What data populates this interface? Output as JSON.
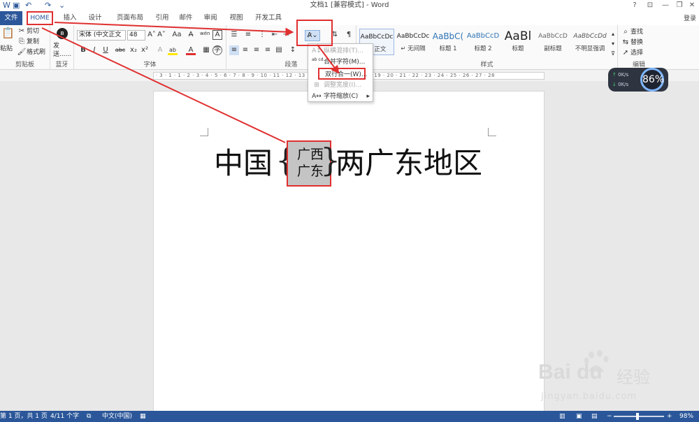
{
  "titlebar": {
    "title": "文档1 [兼容模式] - Word",
    "undo": "↶",
    "redo": "↷",
    "help": "?",
    "minimize": "—",
    "restore": "❐",
    "close": "✕"
  },
  "tabs": {
    "file": "文件",
    "home": "HOME",
    "items": [
      "插入",
      "设计",
      "页面布局",
      "引用",
      "邮件",
      "审阅",
      "视图",
      "开发工具"
    ],
    "login": "登录"
  },
  "clipboard": {
    "paste": "粘贴",
    "cut": "剪切",
    "copy": "复制",
    "format_painter": "格式刷",
    "group": "剪贴板",
    "send": "发送......",
    "bluetooth_group": "蓝牙"
  },
  "font": {
    "name": "宋体 (中文正文",
    "size": "48",
    "group": "字体",
    "grow": "A˄",
    "shrink": "A˅",
    "case": "Aa",
    "clear": "A̶",
    "phonetic": "wén",
    "border_char": "A",
    "bold": "B",
    "italic": "I",
    "underline": "U",
    "strike": "abc",
    "subscript": "x₂",
    "superscript": "x²",
    "highlight": "ab",
    "font_color": "A"
  },
  "paragraph": {
    "group": "段落"
  },
  "styles": {
    "group": "样式",
    "items": [
      {
        "sample": "AaBbCcDc",
        "name": "↵ 正文"
      },
      {
        "sample": "AaBbCcDc",
        "name": "↵ 无间隔"
      },
      {
        "sample": "AaBbC(",
        "name": "标题 1"
      },
      {
        "sample": "AaBbCcD",
        "name": "标题 2"
      },
      {
        "sample": "AaBl",
        "name": "标题"
      },
      {
        "sample": "AaBbCcD",
        "name": "副标题"
      },
      {
        "sample": "AaBbCcDd",
        "name": "不明显强调"
      }
    ]
  },
  "editing": {
    "find": "查找",
    "replace": "替换",
    "select": "选择",
    "group": "编辑"
  },
  "menu": {
    "items": [
      {
        "icon": "A↕",
        "label": "纵横混排(T)...",
        "disabled": true
      },
      {
        "icon": "ab cd",
        "label": "合并字符(M)...",
        "disabled": false
      },
      {
        "icon": "",
        "label": "双行合一(W)...",
        "disabled": false
      },
      {
        "icon": "⊞",
        "label": "调整宽度(I)...",
        "disabled": true
      },
      {
        "icon": "A↔",
        "label": "字符缩放(C)",
        "disabled": false,
        "arrow": "▸"
      }
    ]
  },
  "document": {
    "before": "中国",
    "brace_open": "{",
    "line1": "广西",
    "line2": "广东",
    "brace_close": "}",
    "after": "两广东地区"
  },
  "network": {
    "up": "0K/s",
    "down": "0K/s",
    "percent": "86%"
  },
  "statusbar": {
    "page": "第 1 页，共 1 页",
    "words": "4/11 个字",
    "language": "中文(中国)",
    "zoom_minus": "−",
    "zoom_plus": "+",
    "zoom": "98%"
  },
  "watermark": {
    "brand": "Bai du",
    "cn": "经验",
    "url": "jingyan.baidu.com"
  },
  "colors": {
    "accent": "#2b579a",
    "annotation": "#e03030",
    "selection": "#c4c4c4"
  }
}
